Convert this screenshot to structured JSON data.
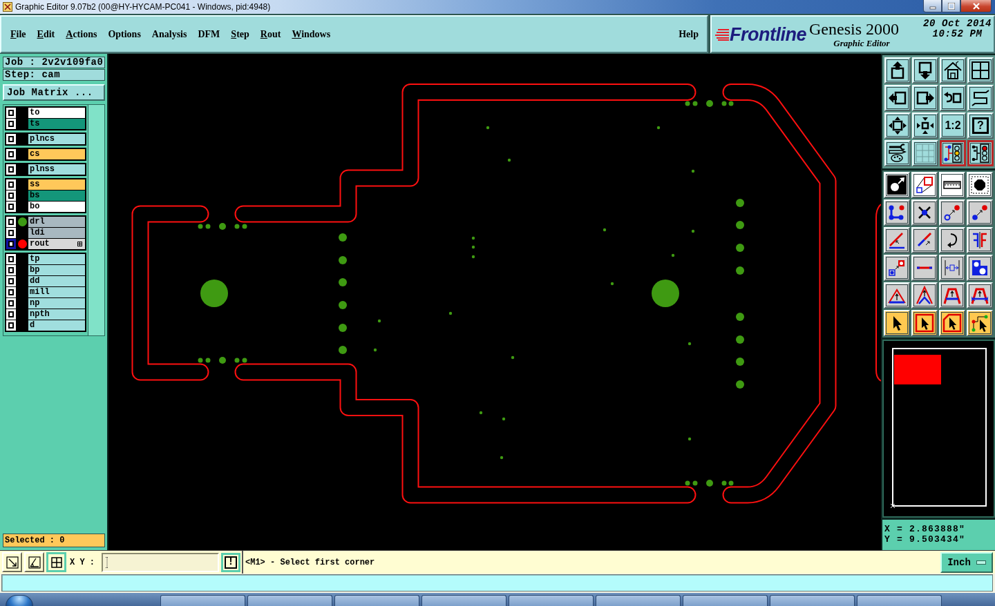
{
  "window": {
    "title": "Graphic Editor 9.07b2 (00@HY-HYCAM-PC041 - Windows, pid:4948)"
  },
  "menu": [
    {
      "label": "File",
      "underlined": true
    },
    {
      "label": "Edit",
      "underlined": true
    },
    {
      "label": "Actions",
      "underlined": true
    },
    {
      "label": "Options",
      "underlined": false
    },
    {
      "label": "Analysis",
      "underlined": false
    },
    {
      "label": "DFM",
      "underlined": false
    },
    {
      "label": "Step",
      "underlined": true
    },
    {
      "label": "Rout",
      "underlined": true
    },
    {
      "label": "Windows",
      "underlined": true
    }
  ],
  "help": {
    "label": "Help"
  },
  "brand": {
    "logo": "Frontline",
    "product": "Genesis 2000",
    "subtitle": "Graphic Editor",
    "date": "20 Oct 2014",
    "time": "10:52 PM"
  },
  "job": {
    "job": "Job : 2v2v109fa0",
    "step": "Step: cam",
    "matrix_button": "Job Matrix ..."
  },
  "layer_groups": [
    {
      "layers": [
        {
          "name": "to",
          "color": "#ffffff",
          "checked": true,
          "selected": false
        },
        {
          "name": "ts",
          "color": "#14967a",
          "checked": true,
          "selected": false
        }
      ]
    },
    {
      "layers": [
        {
          "name": "plncs",
          "color": "#a0dede",
          "checked": true,
          "selected": false
        }
      ]
    },
    {
      "layers": [
        {
          "name": "cs",
          "color": "#ffc85a",
          "checked": true,
          "selected": false
        }
      ]
    },
    {
      "layers": [
        {
          "name": "plnss",
          "color": "#a0dede",
          "checked": true,
          "selected": false
        }
      ]
    },
    {
      "layers": [
        {
          "name": "ss",
          "color": "#ffc85a",
          "checked": true,
          "selected": false
        },
        {
          "name": "bs",
          "color": "#14967a",
          "checked": true,
          "selected": false
        },
        {
          "name": "bo",
          "color": "#ffffff",
          "checked": true,
          "selected": false
        }
      ]
    },
    {
      "layers": [
        {
          "name": "drl",
          "color": "#a8b8c0",
          "checked": true,
          "selected": false,
          "display": {
            "color": "#3c9a14"
          }
        },
        {
          "name": "ldi",
          "color": "#a8b8c0",
          "checked": true,
          "selected": false
        },
        {
          "name": "rout",
          "color": "#d8d8d8",
          "checked": true,
          "selected": true,
          "display": {
            "color": "#ff0000"
          }
        }
      ]
    },
    {
      "layers": [
        {
          "name": "tp",
          "color": "#a0dede",
          "checked": true,
          "selected": false
        },
        {
          "name": "bp",
          "color": "#a0dede",
          "checked": true,
          "selected": false
        },
        {
          "name": "dd",
          "color": "#a0dede",
          "checked": true,
          "selected": false
        },
        {
          "name": "mill",
          "color": "#a0dede",
          "checked": true,
          "selected": false
        },
        {
          "name": "np",
          "color": "#a0dede",
          "checked": true,
          "selected": false
        },
        {
          "name": "npth",
          "color": "#a0dede",
          "checked": true,
          "selected": false
        },
        {
          "name": "d",
          "color": "#a0dede",
          "checked": true,
          "selected": false
        }
      ]
    }
  ],
  "selected_count": "Selected : 0",
  "view_tools": [
    {
      "kind": "icon",
      "selected": false
    },
    {
      "kind": "icon",
      "selected": false
    },
    {
      "kind": "icon",
      "selected": false
    },
    {
      "kind": "icon",
      "selected": false
    },
    {
      "kind": "icon",
      "selected": false
    },
    {
      "kind": "icon",
      "selected": false
    },
    {
      "kind": "icon",
      "selected": false
    },
    {
      "kind": "icon",
      "selected": false
    },
    {
      "kind": "icon",
      "selected": false
    },
    {
      "kind": "icon",
      "selected": false
    },
    {
      "kind": "text",
      "label": "1:2",
      "selected": false
    },
    {
      "kind": "framed_text",
      "label": "?",
      "selected": false
    },
    {
      "kind": "icon",
      "selected": false
    },
    {
      "kind": "icon",
      "selected": false
    },
    {
      "kind": "icon",
      "selected": true
    },
    {
      "kind": "icon",
      "selected": true
    }
  ],
  "coordinates": {
    "x": "X = 2.863888\"",
    "y": "Y = 9.503434\""
  },
  "status": {
    "snap_buttons": [
      {
        "selected": false
      },
      {
        "selected": false
      },
      {
        "selected": true
      }
    ],
    "xy_label": "X Y :",
    "alert_button": "!",
    "message": "<M1> - Select first corner",
    "units": "Inch"
  }
}
